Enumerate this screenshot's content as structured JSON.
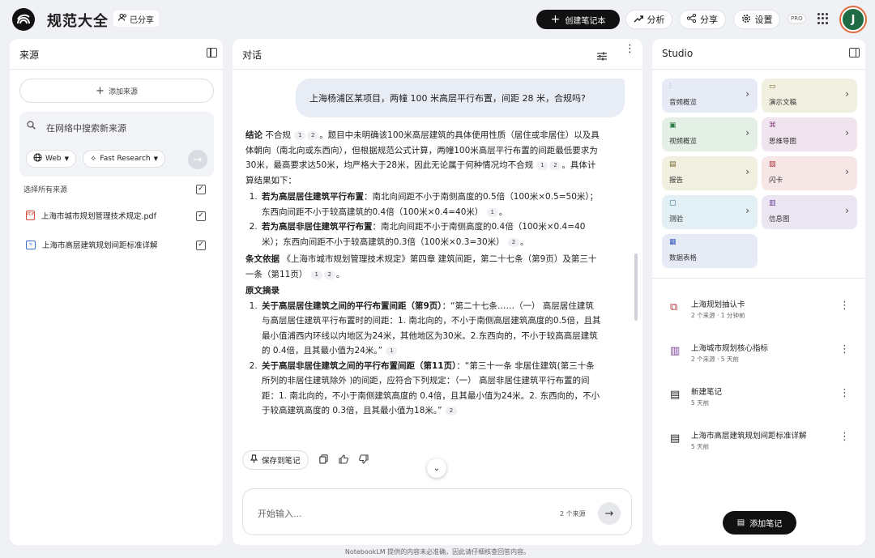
{
  "header": {
    "app_title": "规范大全",
    "shared_label": "已分享",
    "create_notebook": "创建笔记本",
    "analyze": "分析",
    "share": "分享",
    "settings": "设置",
    "pro_badge": "PRO",
    "avatar_initial": "J"
  },
  "sources": {
    "title": "来源",
    "add_source": "添加来源",
    "search_placeholder": "在网络中搜索新来源",
    "web_chip": "Web",
    "research_chip": "Fast Research",
    "select_all": "选择所有来源",
    "items": [
      {
        "name": "上海市城市规划管理技术规定.pdf",
        "type": "pdf",
        "checked": true
      },
      {
        "name": "上海市高层建筑规划间距标准详解",
        "type": "doc",
        "checked": true
      }
    ]
  },
  "chat": {
    "title": "对话",
    "user_question": "上海杨浦区某项目，两幢 100 米高层平行布置，间距 28 米，合规吗?",
    "answer": {
      "conclusion_label": "结论",
      "conclusion_text": "不合规",
      "conclusion_body": "。题目中未明确该100米高层建筑的具体使用性质（居住或非居住）以及具体朝向（南北向或东西向），但根据规范公式计算，两幢100米高层平行布置的间距最低要求为30米，最高要求达50米，均严格大于28米，因此无论属于何种情况均不合规",
      "conclusion_tail": "。具体计算结果如下：",
      "calc_items": [
        {
          "bold": "若为高层居住建筑平行布置",
          "text": "：南北向间距不小于南侧高度的0.5倍（100米×0.5=50米）；东西向间距不小于较高建筑的0.4倍（100米×0.4=40米）",
          "tail": "。"
        },
        {
          "bold": "若为高层非居住建筑平行布置",
          "text": "：南北向间距不小于南侧高度的0.4倍（100米×0.4=40米）；东西向间距不小于较高建筑的0.3倍（100米×0.3=30米）",
          "tail": "。"
        }
      ],
      "basis_label": "条文依据",
      "basis_text": "《上海市城市规划管理技术规定》第四章 建筑间距，第二十七条（第9页）及第三十一条（第11页）",
      "basis_tail": "。",
      "excerpt_label": "原文摘录",
      "excerpt_items": [
        {
          "bold": "关于高层居住建筑之间的平行布置间距（第9页）",
          "text": "：“第二十七条……（一） 高层居住建筑与高层居住建筑平行布置时的间距：1. 南北向的，不小于南侧高层建筑高度的0.5倍，且其最小值浦西内环线以内地区为24米，其他地区为30米。2.东西向的，不小于较高高层建筑的 0.4倍，且其最小值为24米。”",
          "cite": "1"
        },
        {
          "bold": "关于高层非居住建筑之间的平行布置间距（第11页）",
          "text": "：“第三十一条 非居住建筑(第三十条所列的非居住建筑除外 )的间距，应符合下列规定：（一） 高层非居住建筑平行布置的间距：1. 南北向的，不小于南侧建筑高度的 0.4倍，且其最小值为24米。2. 东西向的，不小于较高建筑高度的 0.3倍，且其最小值为18米。”",
          "cite": "2"
        }
      ]
    },
    "save_to_note": "保存到笔记",
    "input_placeholder": "开始输入...",
    "source_count": "2 个来源",
    "cite_1": "1",
    "cite_2": "2"
  },
  "studio": {
    "title": "Studio",
    "tiles": [
      {
        "label": "音频概览",
        "icon": "audio-icon",
        "color": "#e6ebf6"
      },
      {
        "label": "演示文稿",
        "icon": "slides-icon",
        "color": "#f0efe0"
      },
      {
        "label": "视频概览",
        "icon": "video-icon",
        "color": "#e4efe6"
      },
      {
        "label": "思维导图",
        "icon": "mindmap-icon",
        "color": "#f0e4ee"
      },
      {
        "label": "报告",
        "icon": "report-icon",
        "color": "#f0efe0"
      },
      {
        "label": "闪卡",
        "icon": "flashcard-icon",
        "color": "#f7e6e6"
      },
      {
        "label": "测验",
        "icon": "quiz-icon",
        "color": "#e2eff4"
      },
      {
        "label": "信息图",
        "icon": "infographic-icon",
        "color": "#ece6f3"
      },
      {
        "label": "数据表格",
        "icon": "table-icon",
        "color": "#e6ebf6"
      }
    ],
    "notes": [
      {
        "title": "上海规划抽认卡",
        "meta": "2 个来源 · 1 分钟前",
        "icon": "flashcard-icon"
      },
      {
        "title": "上海城市规划核心指标",
        "meta": "2 个来源 · 5 天前",
        "icon": "infographic-icon"
      },
      {
        "title": "新建笔记",
        "meta": "5 天前",
        "icon": "note-icon"
      },
      {
        "title": "上海市高层建筑规划间距标准详解",
        "meta": "5 天前",
        "icon": "note-icon"
      }
    ],
    "add_note": "添加笔记"
  },
  "footer": {
    "disclaimer": "NotebookLM 提供的内容未必准确，因此请仔细核查回答内容。"
  }
}
